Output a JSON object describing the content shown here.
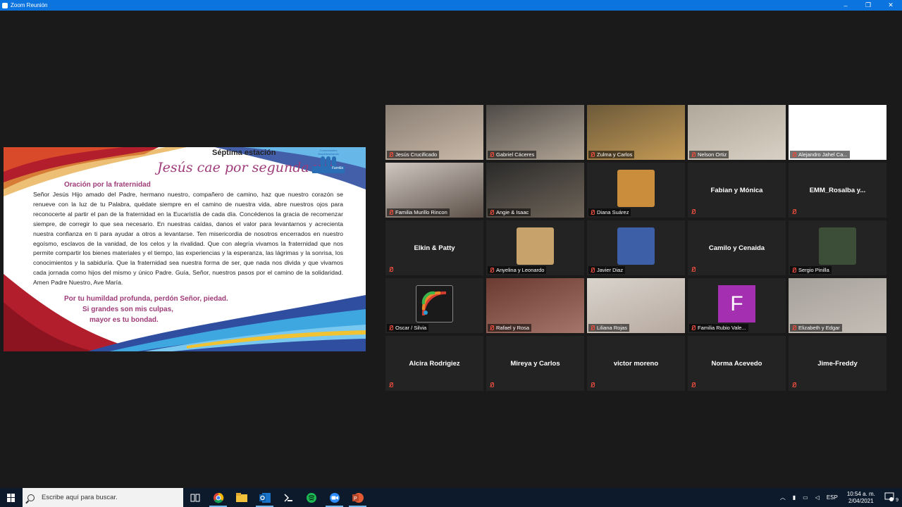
{
  "window": {
    "title": "Zoom Reunión",
    "controls": [
      "–",
      "❐",
      "✕"
    ]
  },
  "slide": {
    "station": "Séptima estación",
    "subtitle": "Jesús cae por segunda vez",
    "logo_text": "Comunidades Arquidiocesanas",
    "logo_word": "Familia",
    "section": "Oración por la fraternidad",
    "body": "Señor Jesús Hijo amado del Padre, hermano nuestro, compañero de camino, haz que nuestro corazón se renueve con la luz de tu Palabra, quédate siempre en el camino de nuestra vida, abre nuestros ojos para reconocerte al partir el pan de la fraternidad en la Eucaristía de cada día. Concédenos la gracia de recomenzar siempre, de corregir lo que sea necesario. En nuestras caídas, danos el valor para levantarnos y acrecienta nuestra confianza en ti para ayudar a otros a levantarse. Ten misericordia de nosotros encerrados en nuestro egoísmo, esclavos de la vanidad, de los celos y la rivalidad. Que con alegría vivamos la fraternidad que nos permite compartir los bienes materiales y el tiempo, las experiencias y la esperanza, las lágrimas y la sonrisa, los conocimientos y la sabiduría. Que la fraternidad sea nuestra forma de ser, que nada nos divida y que vivamos cada jornada como hijos del mismo y único Padre. Guía, Señor, nuestros pasos por el camino de la solidaridad. Amen Padre Nuestro, Ave María.",
    "verse_1": "Por tu humildad profunda, perdón Señor, piedad.",
    "verse_2": "Si grandes son mis culpas,",
    "verse_3": "mayor es tu bondad."
  },
  "participants": [
    {
      "name": "Jesús Crucificado",
      "kind": "video",
      "active": true
    },
    {
      "name": "Gabriel Cáceres",
      "kind": "video"
    },
    {
      "name": "Zulma y Carlos",
      "kind": "video"
    },
    {
      "name": "Nelson Ortiz",
      "kind": "video"
    },
    {
      "name": "Alejandro Jahel Ca...",
      "kind": "video"
    },
    {
      "name": "Familia Murillo Rincon",
      "kind": "video"
    },
    {
      "name": "Angie & Isaac",
      "kind": "video"
    },
    {
      "name": "Diana Suárez",
      "kind": "thumb"
    },
    {
      "name": "Fabian y Mónica",
      "kind": "nameonly"
    },
    {
      "name": "EMM_Rosalba y...",
      "kind": "nameonly"
    },
    {
      "name": "Elkin & Patty",
      "kind": "nameonly"
    },
    {
      "name": "Anyelina y Leonardo",
      "kind": "thumb"
    },
    {
      "name": "Javier Diaz",
      "kind": "thumb"
    },
    {
      "name": "Camilo y Cenaida",
      "kind": "nameonly"
    },
    {
      "name": "Sergio Pinilla",
      "kind": "thumb"
    },
    {
      "name": "Oscar / Silvia",
      "kind": "thumb"
    },
    {
      "name": "Rafael y Rosa",
      "kind": "video"
    },
    {
      "name": "Liliana Rojas",
      "kind": "video"
    },
    {
      "name": "Familia Rubio Vale...",
      "kind": "avatar",
      "initial": "F"
    },
    {
      "name": "Elizabeth y Edgar",
      "kind": "video"
    },
    {
      "name": "Alcira Rodrigiez",
      "kind": "nameonly"
    },
    {
      "name": "Mireya y Carlos",
      "kind": "nameonly"
    },
    {
      "name": "victor moreno",
      "kind": "nameonly"
    },
    {
      "name": "Norma Acevedo",
      "kind": "nameonly"
    },
    {
      "name": "Jime-Freddy",
      "kind": "nameonly"
    }
  ],
  "taskbar": {
    "search_placeholder": "Escribe aquí para buscar.",
    "lang": "ESP",
    "time": "10:54 a. m.",
    "date": "2/04/2021",
    "notifications": "9"
  },
  "colors": {
    "accent": "#cde234",
    "titlebar": "#0b74de",
    "slide_purple": "#9e3b78",
    "muted_mic": "#e74c3c"
  }
}
